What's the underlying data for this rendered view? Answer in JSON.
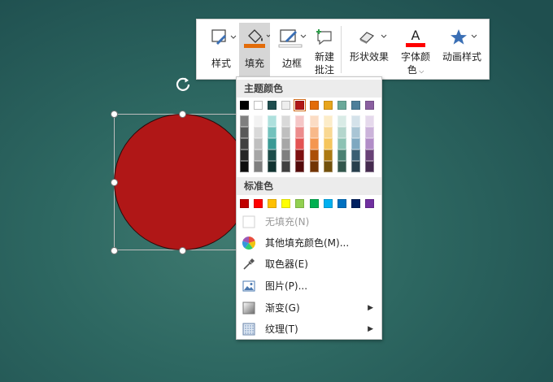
{
  "toolbar": {
    "style_label": "样式",
    "fill_label": "填充",
    "border_label": "边框",
    "new_comment_label_1": "新建",
    "new_comment_label_2": "批注",
    "shape_effects_label": "形状效果",
    "font_color_label_1": "字体颜",
    "font_color_label_2": "色",
    "animation_style_label": "动画样式",
    "fill_accent_color": "#e36c09",
    "font_accent_color": "#ff0000",
    "star_color": "#3a6fb5"
  },
  "shape": {
    "fill_color": "#b01717",
    "type": "circle"
  },
  "fill_menu": {
    "theme_colors_header": "主题颜色",
    "standard_colors_header": "标准色",
    "theme_top_row": [
      "#000000",
      "#ffffff",
      "#1f4e4f",
      "#eeeeee",
      "#b01717",
      "#e36c09",
      "#e8a51c",
      "#6aa99a",
      "#4e7f9a",
      "#8a5fa0"
    ],
    "theme_shades": [
      [
        "#7f7f7f",
        "#f2f2f2",
        "#aee0dd",
        "#d9d9d9",
        "#f5c6c6",
        "#fbdcc4",
        "#fcecc8",
        "#d9ebe6",
        "#d4e2ea",
        "#e5d9ec"
      ],
      [
        "#595959",
        "#d9d9d9",
        "#73c2bd",
        "#bfbfbf",
        "#ec8c8c",
        "#f8b98a",
        "#f9d892",
        "#b4d6cd",
        "#a9c5d5",
        "#cbb3da"
      ],
      [
        "#404040",
        "#bfbfbf",
        "#3a9a95",
        "#a6a6a6",
        "#e35353",
        "#f4964f",
        "#f5c55c",
        "#8dc2b4",
        "#7ea8c0",
        "#b18dc7"
      ],
      [
        "#262626",
        "#a6a6a6",
        "#1c4d4a",
        "#7f7f7f",
        "#7e1010",
        "#ab4e06",
        "#ad7a12",
        "#4b8172",
        "#3a5f73",
        "#684176"
      ],
      [
        "#0d0d0d",
        "#808080",
        "#113331",
        "#404040",
        "#540b0b",
        "#723404",
        "#73510c",
        "#32564c",
        "#273f4d",
        "#452b4f"
      ]
    ],
    "standard_colors": [
      "#c00000",
      "#ff0000",
      "#ffc000",
      "#ffff00",
      "#92d050",
      "#00b050",
      "#00b0f0",
      "#0070c0",
      "#002060",
      "#7030a0"
    ],
    "no_fill_label": "无填充(N)",
    "more_colors_label": "其他填充颜色(M)...",
    "eyedropper_label": "取色器(E)",
    "picture_label": "图片(P)...",
    "gradient_label": "渐变(G)",
    "texture_label": "纹理(T)"
  }
}
